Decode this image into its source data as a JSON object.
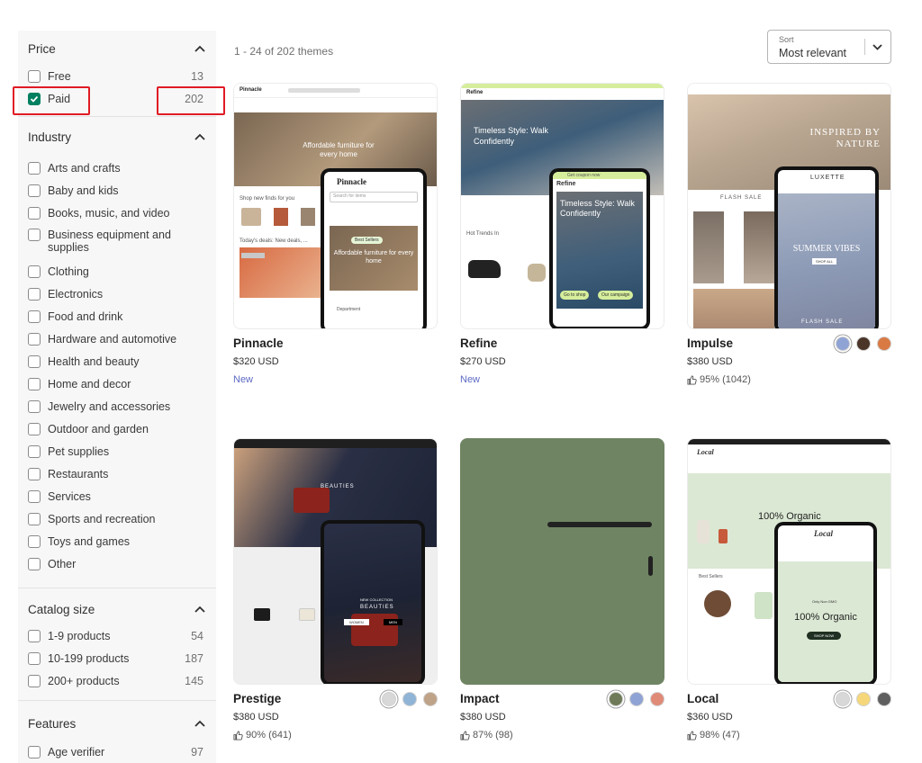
{
  "sidebar": {
    "price": {
      "title": "Price",
      "options": [
        {
          "label": "Free",
          "count": "13",
          "checked": false
        },
        {
          "label": "Paid",
          "count": "202",
          "checked": true
        }
      ]
    },
    "industry": {
      "title": "Industry",
      "options": [
        "Arts and crafts",
        "Baby and kids",
        "Books, music, and video",
        "Business equipment and supplies",
        "Clothing",
        "Electronics",
        "Food and drink",
        "Hardware and automotive",
        "Health and beauty",
        "Home and decor",
        "Jewelry and accessories",
        "Outdoor and garden",
        "Pet supplies",
        "Restaurants",
        "Services",
        "Sports and recreation",
        "Toys and games",
        "Other"
      ]
    },
    "catalog": {
      "title": "Catalog size",
      "options": [
        {
          "label": "1-9 products",
          "count": "54"
        },
        {
          "label": "10-199 products",
          "count": "187"
        },
        {
          "label": "200+ products",
          "count": "145"
        }
      ]
    },
    "features": {
      "title": "Features",
      "options": [
        {
          "label": "Age verifier",
          "count": "97"
        }
      ]
    }
  },
  "results": {
    "summary": "1 - 24 of 202 themes"
  },
  "sort": {
    "label": "Sort",
    "value": "Most relevant"
  },
  "themes": [
    {
      "name": "Pinnacle",
      "price": "$320 USD",
      "tag": "New",
      "preview": {
        "brand": "Pinnacle",
        "hero": "Affordable furniture for every home",
        "phone_hero": "Affordable furniture for every home",
        "search": "Search for items",
        "dept": "Department",
        "cta": "Best Sellers",
        "section": "Shop new finds for you",
        "deals": "Today's deals: New deals, ..."
      }
    },
    {
      "name": "Refine",
      "price": "$270 USD",
      "tag": "New",
      "preview": {
        "brand": "Refine",
        "hero": "Timeless Style: Walk Confidently",
        "phone_hero": "Timeless Style: Walk Confidently",
        "hot": "Hot Trends In",
        "promo": "Get coupon now",
        "b1": "Go to shop",
        "b2": "Our campaign"
      }
    },
    {
      "name": "Impulse",
      "price": "$380 USD",
      "rating": "95% (1042)",
      "swatches": [
        "#8fa3d4",
        "#4a3528",
        "#d97a45"
      ],
      "preview": {
        "brand": "LUXETTE",
        "hero": "INSPIRED BY NATURE",
        "flash": "FLASH SALE",
        "phone_hero": "SUMMER VIBES",
        "cta": "SHOP ALL"
      }
    },
    {
      "name": "Prestige",
      "price": "$380 USD",
      "rating": "90% (641)",
      "swatches": [
        "#d8d8d8",
        "#8fb4d6",
        "#bfa388"
      ],
      "preview": {
        "hero": "BEAUTIES",
        "phone_hero": "BEAUTIES",
        "sub": "NEW COLLECTION",
        "b1": "WOMEN",
        "b2": "MEN"
      }
    },
    {
      "name": "Impact",
      "price": "$380 USD",
      "rating": "87% (98)",
      "swatches": [
        "#6e7a58",
        "#8fa3d4",
        "#e08a78"
      ]
    },
    {
      "name": "Local",
      "price": "$360 USD",
      "rating": "98% (47)",
      "swatches": [
        "#d8d8d8",
        "#f5d77a",
        "#5f5f5f"
      ],
      "preview": {
        "brand": "Local",
        "hero": "100% Organic",
        "phone_hero": "100% Organic",
        "best": "Best Sellers",
        "cta": "SHOP NOW",
        "small": "Only Non GMO"
      }
    }
  ],
  "colors": {
    "accent_green": "#008060",
    "new_tag": "#5c6ac4",
    "highlight": "#e01b24",
    "impact_bg": "#6f8463"
  }
}
